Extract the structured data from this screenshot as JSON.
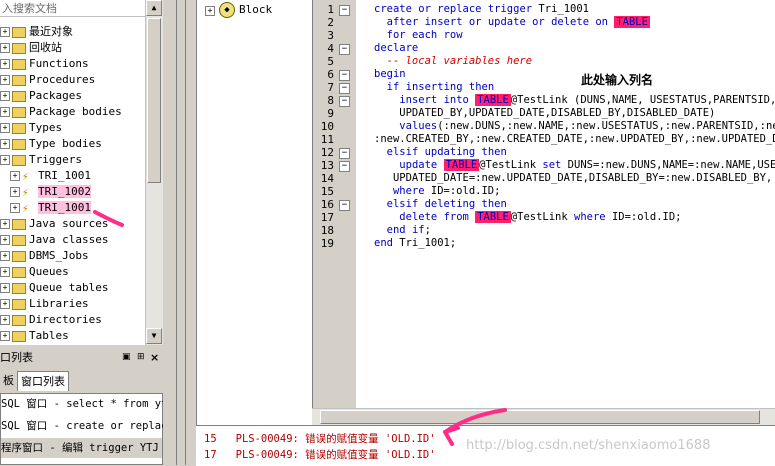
{
  "object_browser": {
    "filter_placeholder": "入搜索文档",
    "items": [
      {
        "label": "最近对象",
        "kind": "folder",
        "expandable": true
      },
      {
        "label": "回收站",
        "kind": "folder",
        "expandable": true
      },
      {
        "label": "Functions",
        "kind": "folder",
        "expandable": true
      },
      {
        "label": "Procedures",
        "kind": "folder",
        "expandable": true
      },
      {
        "label": "Packages",
        "kind": "folder",
        "expandable": true
      },
      {
        "label": "Package bodies",
        "kind": "folder",
        "expandable": true
      },
      {
        "label": "Types",
        "kind": "folder",
        "expandable": true
      },
      {
        "label": "Type bodies",
        "kind": "folder",
        "expandable": true
      },
      {
        "label": "Triggers",
        "kind": "folder",
        "expandable": true
      },
      {
        "label": "TRI_1001",
        "kind": "trigger",
        "expandable": true
      },
      {
        "label": "TRI_1002",
        "kind": "trigger",
        "expandable": true
      },
      {
        "label": "TRI_1001",
        "kind": "trigger",
        "expandable": true
      },
      {
        "label": "Java sources",
        "kind": "folder",
        "expandable": true
      },
      {
        "label": "Java classes",
        "kind": "folder",
        "expandable": true
      },
      {
        "label": "DBMS_Jobs",
        "kind": "folder",
        "expandable": true
      },
      {
        "label": "Queues",
        "kind": "folder",
        "expandable": true
      },
      {
        "label": "Queue tables",
        "kind": "folder",
        "expandable": true
      },
      {
        "label": "Libraries",
        "kind": "folder",
        "expandable": true
      },
      {
        "label": "Directories",
        "kind": "folder",
        "expandable": true
      },
      {
        "label": "Tables",
        "kind": "folder",
        "expandable": true
      }
    ]
  },
  "window_list": {
    "title": "口列表",
    "tabs": [
      "板",
      "窗口列表"
    ],
    "items": [
      "SQL 窗口 - select * from yt",
      "SQL 窗口 - create or replac",
      "程序窗口 - 编辑 trigger YTJ"
    ]
  },
  "block_pane": {
    "label": "Block"
  },
  "editor": {
    "annotation": "此处输入列名",
    "lines": [
      {
        "n": "1",
        "fold": "minus",
        "text": "create or replace trigger Tri_1001"
      },
      {
        "n": "2",
        "fold": "",
        "text": "  after insert or update or delete on TABLE"
      },
      {
        "n": "3",
        "fold": "",
        "text": "  for each row"
      },
      {
        "n": "4",
        "fold": "minus",
        "text": "declare"
      },
      {
        "n": "5",
        "fold": "",
        "text": "  -- local variables here"
      },
      {
        "n": "6",
        "fold": "minus",
        "text": "begin"
      },
      {
        "n": "7",
        "fold": "minus",
        "text": "  if inserting then"
      },
      {
        "n": "8",
        "fold": "minus",
        "text": "    insert into TABLE@TestLink (DUNS,NAME, USESTATUS,PARENTSID,ADD"
      },
      {
        "n": "9",
        "fold": "",
        "text": "    UPDATED_BY,UPDATED_DATE,DISABLED_BY,DISABLED_DATE)"
      },
      {
        "n": "10",
        "fold": "",
        "text": "    values(:new.DUNS,:new.NAME,:new.USESTATUS,:new.PARENTSID,:new.A"
      },
      {
        "n": "11",
        "fold": "",
        "text": ":new.CREATED_BY,:new.CREATED_DATE,:new.UPDATED_BY,:new.UPDATED_DA"
      },
      {
        "n": "12",
        "fold": "minus",
        "text": "  elsif updating then"
      },
      {
        "n": "13",
        "fold": "minus",
        "text": "    update TABLE@TestLink set DUNS=:new.DUNS,NAME=:new.NAME,USES"
      },
      {
        "n": "14",
        "fold": "",
        "text": "   UPDATED_DATE=:new.UPDATED_DATE,DISABLED_BY=:new.DISABLED_BY, DIS"
      },
      {
        "n": "15",
        "fold": "",
        "text": "   where ID=:old.ID;"
      },
      {
        "n": "16",
        "fold": "minus",
        "text": "  elsif deleting then"
      },
      {
        "n": "17",
        "fold": "",
        "text": "    delete from TABLE@TestLink where ID=:old.ID;"
      },
      {
        "n": "18",
        "fold": "",
        "text": "  end if;"
      },
      {
        "n": "19",
        "fold": "",
        "text": "end Tri_1001;"
      }
    ]
  },
  "messages": [
    {
      "line": "15",
      "text": "PLS-00049: 错误的赋值变量 'OLD.ID'"
    },
    {
      "line": "17",
      "text": "PLS-00049: 错误的赋值变量 'OLD.ID'"
    }
  ],
  "watermark": "http://blog.csdn.net/shenxiaomo1688",
  "colors": {
    "keyword": "#0000c0",
    "comment": "#d00000",
    "highlight": "#ff1f6b",
    "error": "#b00000",
    "annotation_stroke": "#ff2d8a"
  }
}
